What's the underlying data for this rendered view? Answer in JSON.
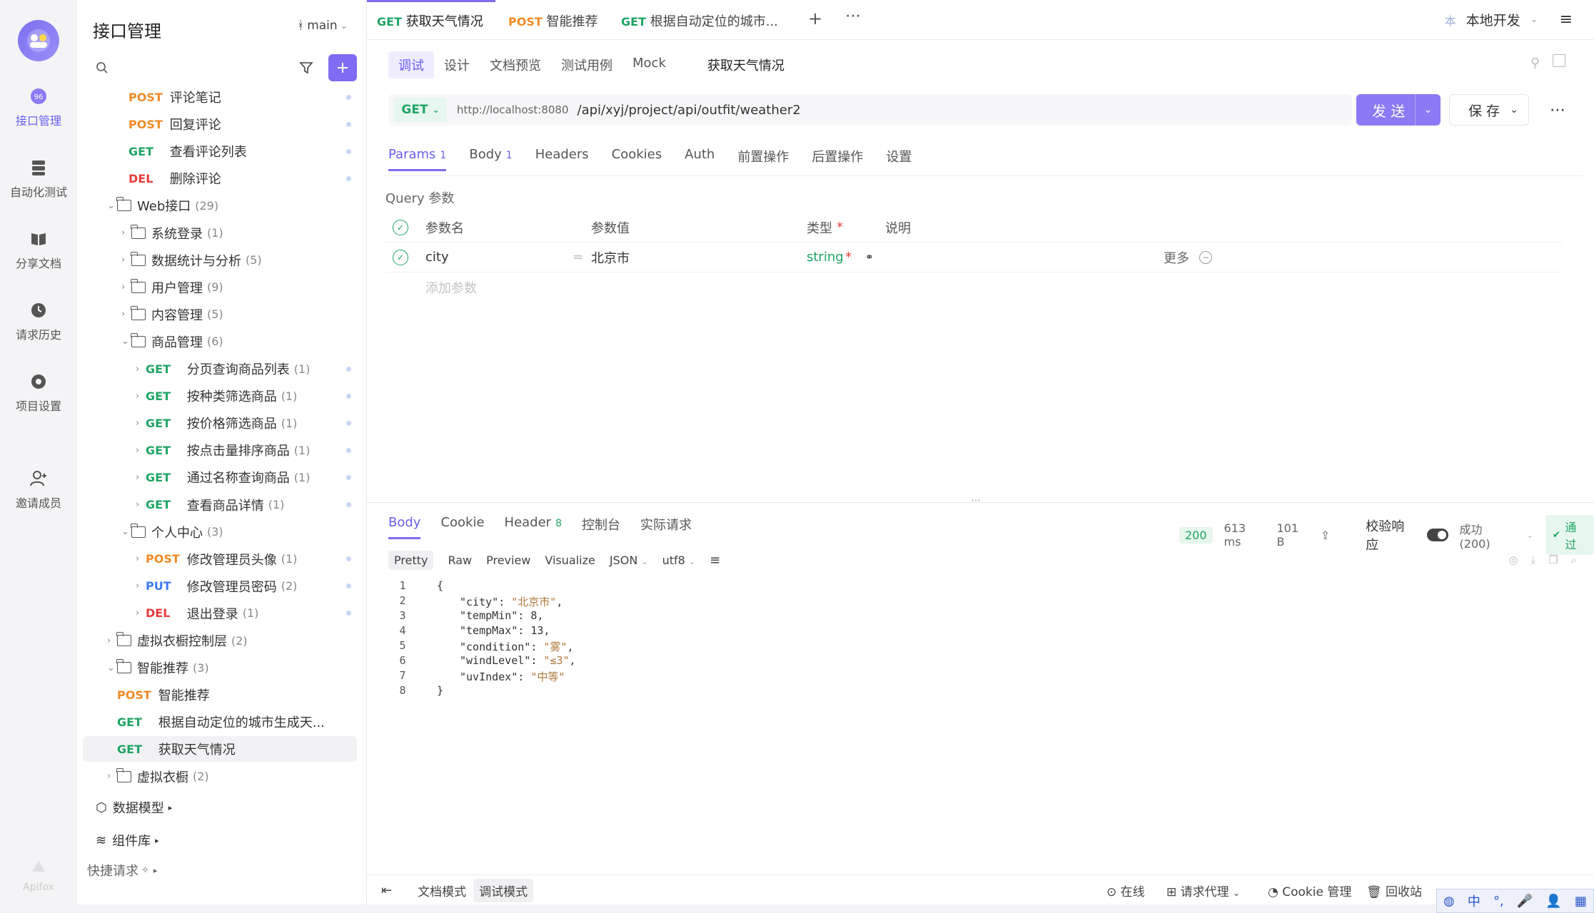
{
  "rail": {
    "items": [
      {
        "label": "接口管理",
        "icon": "api-icon",
        "active": true
      },
      {
        "label": "自动化测试",
        "icon": "automation-icon"
      },
      {
        "label": "分享文档",
        "icon": "book-icon"
      },
      {
        "label": "请求历史",
        "icon": "clock-icon"
      },
      {
        "label": "项目设置",
        "icon": "settings-icon"
      },
      {
        "label": "邀请成员",
        "icon": "invite-user-icon"
      }
    ],
    "brand": "Apifox",
    "logo_badge": "96"
  },
  "tree": {
    "title": "接口管理",
    "branch": "main",
    "rows": [
      {
        "type": "api",
        "method": "POST",
        "name": "评论笔记"
      },
      {
        "type": "api",
        "method": "POST",
        "name": "回复评论"
      },
      {
        "type": "api",
        "method": "GET",
        "name": "查看评论列表"
      },
      {
        "type": "api",
        "method": "DEL",
        "name": "删除评论"
      },
      {
        "type": "folder",
        "name": "Web接口",
        "count": "(29)",
        "expanded": true
      },
      {
        "type": "folder",
        "name": "系统登录",
        "count": "(1)"
      },
      {
        "type": "folder",
        "name": "数据统计与分析",
        "count": "(5)"
      },
      {
        "type": "folder",
        "name": "用户管理",
        "count": "(9)"
      },
      {
        "type": "folder",
        "name": "内容管理",
        "count": "(5)"
      },
      {
        "type": "folder",
        "name": "商品管理",
        "count": "(6)",
        "expanded": true
      },
      {
        "type": "api",
        "method": "GET",
        "name": "分页查询商品列表",
        "count": "(1)"
      },
      {
        "type": "api",
        "method": "GET",
        "name": "按种类筛选商品",
        "count": "(1)"
      },
      {
        "type": "api",
        "method": "GET",
        "name": "按价格筛选商品",
        "count": "(1)"
      },
      {
        "type": "api",
        "method": "GET",
        "name": "按点击量排序商品",
        "count": "(1)"
      },
      {
        "type": "api",
        "method": "GET",
        "name": "通过名称查询商品",
        "count": "(1)"
      },
      {
        "type": "api",
        "method": "GET",
        "name": "查看商品详情",
        "count": "(1)"
      },
      {
        "type": "folder",
        "name": "个人中心",
        "count": "(3)",
        "expanded": true
      },
      {
        "type": "api",
        "method": "POST",
        "name": "修改管理员头像",
        "count": "(1)"
      },
      {
        "type": "api",
        "method": "PUT",
        "name": "修改管理员密码",
        "count": "(2)"
      },
      {
        "type": "api",
        "method": "DEL",
        "name": "退出登录",
        "count": "(1)"
      },
      {
        "type": "folder",
        "name": "虚拟衣橱控制层",
        "count": "(2)"
      },
      {
        "type": "folder",
        "name": "智能推荐",
        "count": "(3)",
        "expanded": true
      },
      {
        "type": "api",
        "method": "POST",
        "name": "智能推荐"
      },
      {
        "type": "api",
        "method": "GET",
        "name": "根据自动定位的城市生成天..."
      },
      {
        "type": "api",
        "method": "GET",
        "name": "获取天气情况",
        "selected": true
      },
      {
        "type": "folder",
        "name": "虚拟衣橱",
        "count": "(2)"
      }
    ],
    "data_model": "数据模型",
    "components": "组件库",
    "quick_request": "快捷请求"
  },
  "tabs": [
    {
      "method": "GET",
      "label": "获取天气情况",
      "active": true
    },
    {
      "method": "POST",
      "label": "智能推荐"
    },
    {
      "method": "GET",
      "label": "根据自动定位的城市..."
    }
  ],
  "env": {
    "label": "本地开发",
    "prefix": "本"
  },
  "subtabs": [
    "调试",
    "设计",
    "文档预览",
    "测试用例",
    "Mock"
  ],
  "api_title": "获取天气情况",
  "request": {
    "method": "GET",
    "host": "http://localhost:8080",
    "path": "/api/xyj/project/api/outfit/weather2",
    "send": "发 送",
    "save": "保 存"
  },
  "req_tabs": [
    {
      "label": "Params",
      "badge": "1",
      "active": true
    },
    {
      "label": "Body",
      "badge": "1"
    },
    {
      "label": "Headers"
    },
    {
      "label": "Cookies"
    },
    {
      "label": "Auth"
    },
    {
      "label": "前置操作"
    },
    {
      "label": "后置操作"
    },
    {
      "label": "设置"
    }
  ],
  "query": {
    "label": "Query 参数",
    "headers": {
      "name": "参数名",
      "value": "参数值",
      "type": "类型",
      "required_mark": "*",
      "desc": "说明"
    },
    "rows": [
      {
        "name": "city",
        "eq": "=",
        "value": "北京市",
        "type": "string",
        "required_mark": "*",
        "more": "更多"
      }
    ],
    "add_placeholder": "添加参数"
  },
  "response": {
    "tabs": [
      {
        "label": "Body",
        "active": true
      },
      {
        "label": "Cookie"
      },
      {
        "label": "Header",
        "badge": "8"
      },
      {
        "label": "控制台"
      },
      {
        "label": "实际请求"
      }
    ],
    "status": "200",
    "time": "613 ms",
    "size": "101 B",
    "validate_label": "校验响应",
    "result": "成功 (200)",
    "pass": "通过",
    "formats": [
      "Pretty",
      "Raw",
      "Preview",
      "Visualize"
    ],
    "lang": "JSON",
    "encoding": "utf8",
    "lines": [
      {
        "n": "1",
        "text": "{"
      },
      {
        "n": "2",
        "key": "\"city\"",
        "val": "\"北京市\""
      },
      {
        "n": "3",
        "key": "\"tempMin\"",
        "val": "8"
      },
      {
        "n": "4",
        "key": "\"tempMax\"",
        "val": "13"
      },
      {
        "n": "5",
        "key": "\"condition\"",
        "val": "\"雾\""
      },
      {
        "n": "6",
        "key": "\"windLevel\"",
        "val": "\"≤3\""
      },
      {
        "n": "7",
        "key": "\"uvIndex\"",
        "val": "\"中等\"",
        "last": true
      },
      {
        "n": "8",
        "text": "}"
      }
    ]
  },
  "bottom": {
    "doc_mode": "文档模式",
    "debug_mode": "调试模式",
    "online": "在线",
    "proxy": "请求代理",
    "cookie": "Cookie 管理",
    "trash": "回收站"
  },
  "ime": {
    "lang": "中"
  }
}
